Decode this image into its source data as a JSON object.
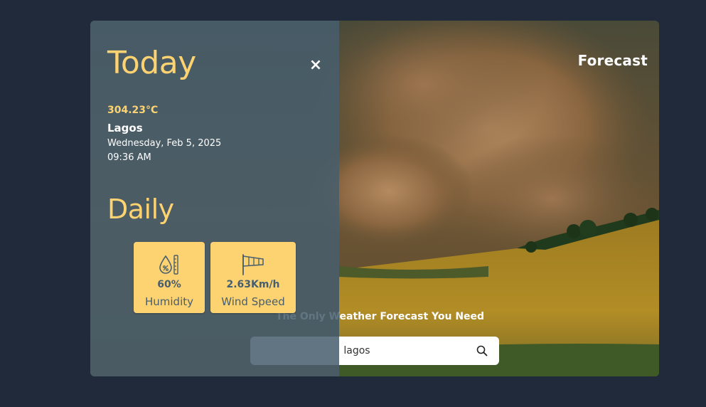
{
  "header": {
    "brand_title": "Forecast"
  },
  "hero": {
    "tagline": "The Only Weather Forecast You Need"
  },
  "search": {
    "value": "lagos",
    "placeholder": "",
    "icon": "search-icon"
  },
  "today_panel": {
    "heading": "Today",
    "close_label": "×",
    "temperature": "304.23°C",
    "city": "Lagos",
    "date": "Wednesday, Feb 5, 2025",
    "time": "09:36 AM"
  },
  "daily": {
    "heading": "Daily",
    "stats": [
      {
        "icon": "humidity-icon",
        "value": "60%",
        "label": "Humidity"
      },
      {
        "icon": "windsock-icon",
        "value": "2.63Km/h",
        "label": "Wind Speed"
      }
    ]
  },
  "colors": {
    "accent": "#fdd271",
    "panel": "#475e6e",
    "page_background": "#212a3b",
    "text_light": "#ffffff"
  }
}
